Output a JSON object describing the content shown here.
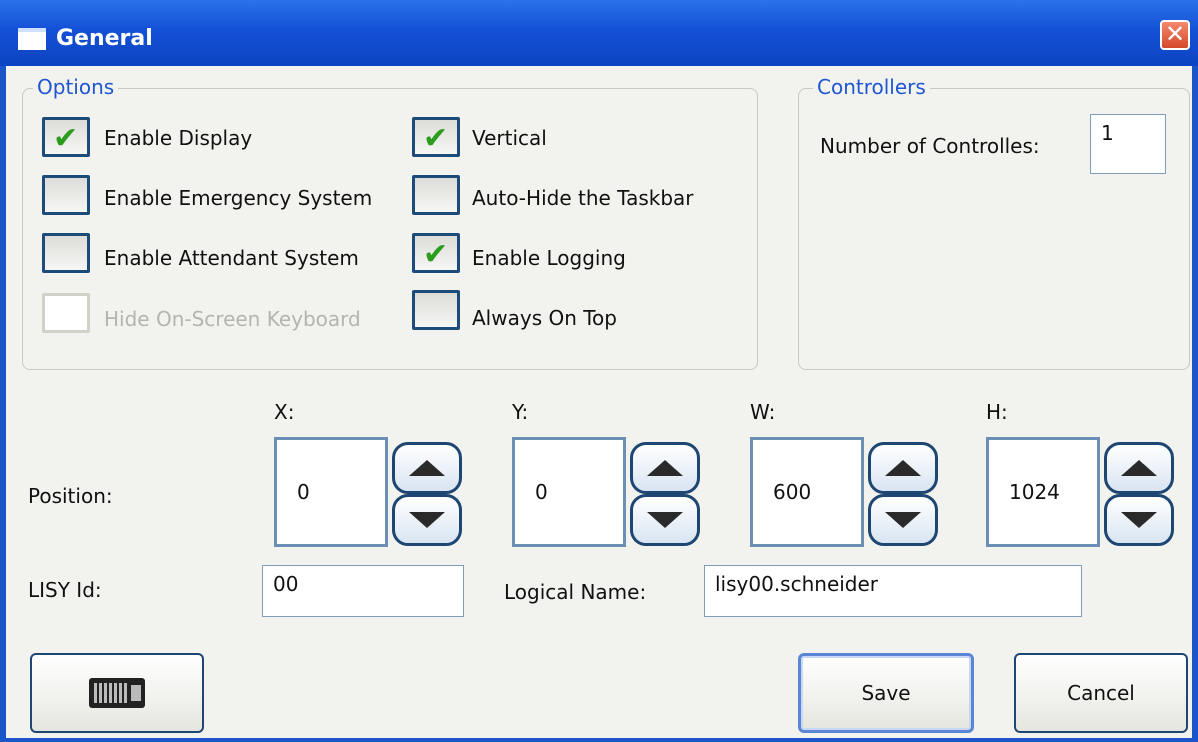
{
  "window": {
    "title": "General",
    "close_symbol": "✕"
  },
  "options": {
    "legend": "Options",
    "items": [
      {
        "label": "Enable Display",
        "checked": true,
        "disabled": false
      },
      {
        "label": "Enable Emergency System",
        "checked": false,
        "disabled": false
      },
      {
        "label": "Enable Attendant System",
        "checked": false,
        "disabled": false
      },
      {
        "label": "Hide On-Screen Keyboard",
        "checked": false,
        "disabled": true
      },
      {
        "label": "Vertical",
        "checked": true,
        "disabled": false
      },
      {
        "label": "Auto-Hide the Taskbar",
        "checked": false,
        "disabled": false
      },
      {
        "label": "Enable Logging",
        "checked": true,
        "disabled": false
      },
      {
        "label": "Always On Top",
        "checked": false,
        "disabled": false
      }
    ]
  },
  "controllers": {
    "legend": "Controllers",
    "count_label": "Number of Controlles:",
    "count_value": "1"
  },
  "position": {
    "label": "Position:",
    "fields": [
      {
        "axis": "X:",
        "value": "0"
      },
      {
        "axis": "Y:",
        "value": "0"
      },
      {
        "axis": "W:",
        "value": "600"
      },
      {
        "axis": "H:",
        "value": "1024"
      }
    ]
  },
  "lisy": {
    "label": "LISY Id:",
    "value": "00"
  },
  "logical": {
    "label": "Logical Name:",
    "value": "lisy00.schneider"
  },
  "buttons": {
    "keyboard_icon": "keyboard-icon",
    "save": "Save",
    "cancel": "Cancel"
  }
}
